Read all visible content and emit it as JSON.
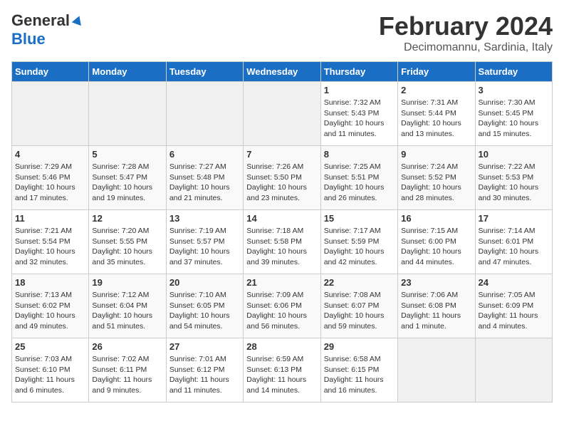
{
  "header": {
    "logo_general": "General",
    "logo_blue": "Blue",
    "main_title": "February 2024",
    "sub_title": "Decimomannu, Sardinia, Italy"
  },
  "columns": [
    "Sunday",
    "Monday",
    "Tuesday",
    "Wednesday",
    "Thursday",
    "Friday",
    "Saturday"
  ],
  "weeks": [
    {
      "days": [
        {
          "num": "",
          "info": ""
        },
        {
          "num": "",
          "info": ""
        },
        {
          "num": "",
          "info": ""
        },
        {
          "num": "",
          "info": ""
        },
        {
          "num": "1",
          "info": "Sunrise: 7:32 AM\nSunset: 5:43 PM\nDaylight: 10 hours\nand 11 minutes."
        },
        {
          "num": "2",
          "info": "Sunrise: 7:31 AM\nSunset: 5:44 PM\nDaylight: 10 hours\nand 13 minutes."
        },
        {
          "num": "3",
          "info": "Sunrise: 7:30 AM\nSunset: 5:45 PM\nDaylight: 10 hours\nand 15 minutes."
        }
      ]
    },
    {
      "days": [
        {
          "num": "4",
          "info": "Sunrise: 7:29 AM\nSunset: 5:46 PM\nDaylight: 10 hours\nand 17 minutes."
        },
        {
          "num": "5",
          "info": "Sunrise: 7:28 AM\nSunset: 5:47 PM\nDaylight: 10 hours\nand 19 minutes."
        },
        {
          "num": "6",
          "info": "Sunrise: 7:27 AM\nSunset: 5:48 PM\nDaylight: 10 hours\nand 21 minutes."
        },
        {
          "num": "7",
          "info": "Sunrise: 7:26 AM\nSunset: 5:50 PM\nDaylight: 10 hours\nand 23 minutes."
        },
        {
          "num": "8",
          "info": "Sunrise: 7:25 AM\nSunset: 5:51 PM\nDaylight: 10 hours\nand 26 minutes."
        },
        {
          "num": "9",
          "info": "Sunrise: 7:24 AM\nSunset: 5:52 PM\nDaylight: 10 hours\nand 28 minutes."
        },
        {
          "num": "10",
          "info": "Sunrise: 7:22 AM\nSunset: 5:53 PM\nDaylight: 10 hours\nand 30 minutes."
        }
      ]
    },
    {
      "days": [
        {
          "num": "11",
          "info": "Sunrise: 7:21 AM\nSunset: 5:54 PM\nDaylight: 10 hours\nand 32 minutes."
        },
        {
          "num": "12",
          "info": "Sunrise: 7:20 AM\nSunset: 5:55 PM\nDaylight: 10 hours\nand 35 minutes."
        },
        {
          "num": "13",
          "info": "Sunrise: 7:19 AM\nSunset: 5:57 PM\nDaylight: 10 hours\nand 37 minutes."
        },
        {
          "num": "14",
          "info": "Sunrise: 7:18 AM\nSunset: 5:58 PM\nDaylight: 10 hours\nand 39 minutes."
        },
        {
          "num": "15",
          "info": "Sunrise: 7:17 AM\nSunset: 5:59 PM\nDaylight: 10 hours\nand 42 minutes."
        },
        {
          "num": "16",
          "info": "Sunrise: 7:15 AM\nSunset: 6:00 PM\nDaylight: 10 hours\nand 44 minutes."
        },
        {
          "num": "17",
          "info": "Sunrise: 7:14 AM\nSunset: 6:01 PM\nDaylight: 10 hours\nand 47 minutes."
        }
      ]
    },
    {
      "days": [
        {
          "num": "18",
          "info": "Sunrise: 7:13 AM\nSunset: 6:02 PM\nDaylight: 10 hours\nand 49 minutes."
        },
        {
          "num": "19",
          "info": "Sunrise: 7:12 AM\nSunset: 6:04 PM\nDaylight: 10 hours\nand 51 minutes."
        },
        {
          "num": "20",
          "info": "Sunrise: 7:10 AM\nSunset: 6:05 PM\nDaylight: 10 hours\nand 54 minutes."
        },
        {
          "num": "21",
          "info": "Sunrise: 7:09 AM\nSunset: 6:06 PM\nDaylight: 10 hours\nand 56 minutes."
        },
        {
          "num": "22",
          "info": "Sunrise: 7:08 AM\nSunset: 6:07 PM\nDaylight: 10 hours\nand 59 minutes."
        },
        {
          "num": "23",
          "info": "Sunrise: 7:06 AM\nSunset: 6:08 PM\nDaylight: 11 hours\nand 1 minute."
        },
        {
          "num": "24",
          "info": "Sunrise: 7:05 AM\nSunset: 6:09 PM\nDaylight: 11 hours\nand 4 minutes."
        }
      ]
    },
    {
      "days": [
        {
          "num": "25",
          "info": "Sunrise: 7:03 AM\nSunset: 6:10 PM\nDaylight: 11 hours\nand 6 minutes."
        },
        {
          "num": "26",
          "info": "Sunrise: 7:02 AM\nSunset: 6:11 PM\nDaylight: 11 hours\nand 9 minutes."
        },
        {
          "num": "27",
          "info": "Sunrise: 7:01 AM\nSunset: 6:12 PM\nDaylight: 11 hours\nand 11 minutes."
        },
        {
          "num": "28",
          "info": "Sunrise: 6:59 AM\nSunset: 6:13 PM\nDaylight: 11 hours\nand 14 minutes."
        },
        {
          "num": "29",
          "info": "Sunrise: 6:58 AM\nSunset: 6:15 PM\nDaylight: 11 hours\nand 16 minutes."
        },
        {
          "num": "",
          "info": ""
        },
        {
          "num": "",
          "info": ""
        }
      ]
    }
  ]
}
